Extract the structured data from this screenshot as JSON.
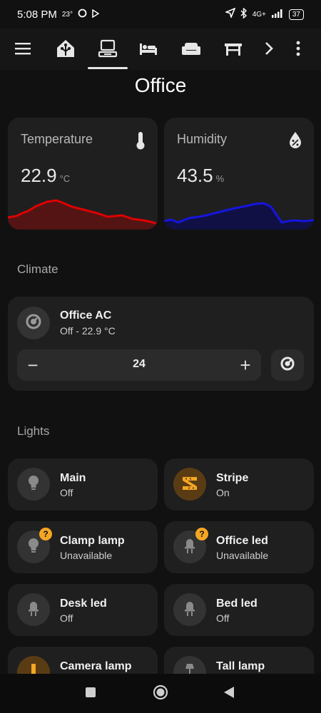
{
  "status_bar": {
    "time": "5:08 PM",
    "temp": "23°",
    "network": "4G+",
    "battery": "37"
  },
  "header": {
    "icons": [
      "menu-icon",
      "home-assistant-icon",
      "desk-icon",
      "bed-icon",
      "sofa-icon",
      "table-icon",
      "chevron-right-icon",
      "more-vert-icon"
    ],
    "active_tab": "desk-icon"
  },
  "page": {
    "title": "Office"
  },
  "sensors": [
    {
      "name": "Temperature",
      "value": "22.9",
      "unit": "°C",
      "icon": "thermometer-icon",
      "color": "#e00000"
    },
    {
      "name": "Humidity",
      "value": "43.5",
      "unit": "%",
      "icon": "water-percent-icon",
      "color": "#1515e0"
    }
  ],
  "climate": {
    "section_title": "Climate",
    "name": "Office AC",
    "state": "Off - 22.9 °C",
    "target": "24",
    "minus": "−",
    "plus": "+"
  },
  "lights": {
    "section_title": "Lights",
    "items": [
      {
        "name": "Main",
        "state": "Off",
        "icon": "lightbulb-icon",
        "active": false,
        "badge": ""
      },
      {
        "name": "Stripe",
        "state": "On",
        "icon": "led-strip-icon",
        "active": true,
        "badge": ""
      },
      {
        "name": "Clamp lamp",
        "state": "Unavailable",
        "icon": "lightbulb-icon",
        "active": false,
        "badge": "?"
      },
      {
        "name": "Office led",
        "state": "Unavailable",
        "icon": "led-icon",
        "active": false,
        "badge": "?"
      },
      {
        "name": "Desk led",
        "state": "Off",
        "icon": "led-icon",
        "active": false,
        "badge": ""
      },
      {
        "name": "Bed led",
        "state": "Off",
        "icon": "led-icon",
        "active": false,
        "badge": ""
      },
      {
        "name": "Camera lamp",
        "state": "",
        "icon": "lamp-icon",
        "active": true,
        "badge": ""
      },
      {
        "name": "Tall lamp",
        "state": "",
        "icon": "floor-lamp-icon",
        "active": false,
        "badge": ""
      }
    ]
  },
  "colors": {
    "accent_on": "#f5a623",
    "background": "#111111",
    "card": "#1f1f1f"
  }
}
